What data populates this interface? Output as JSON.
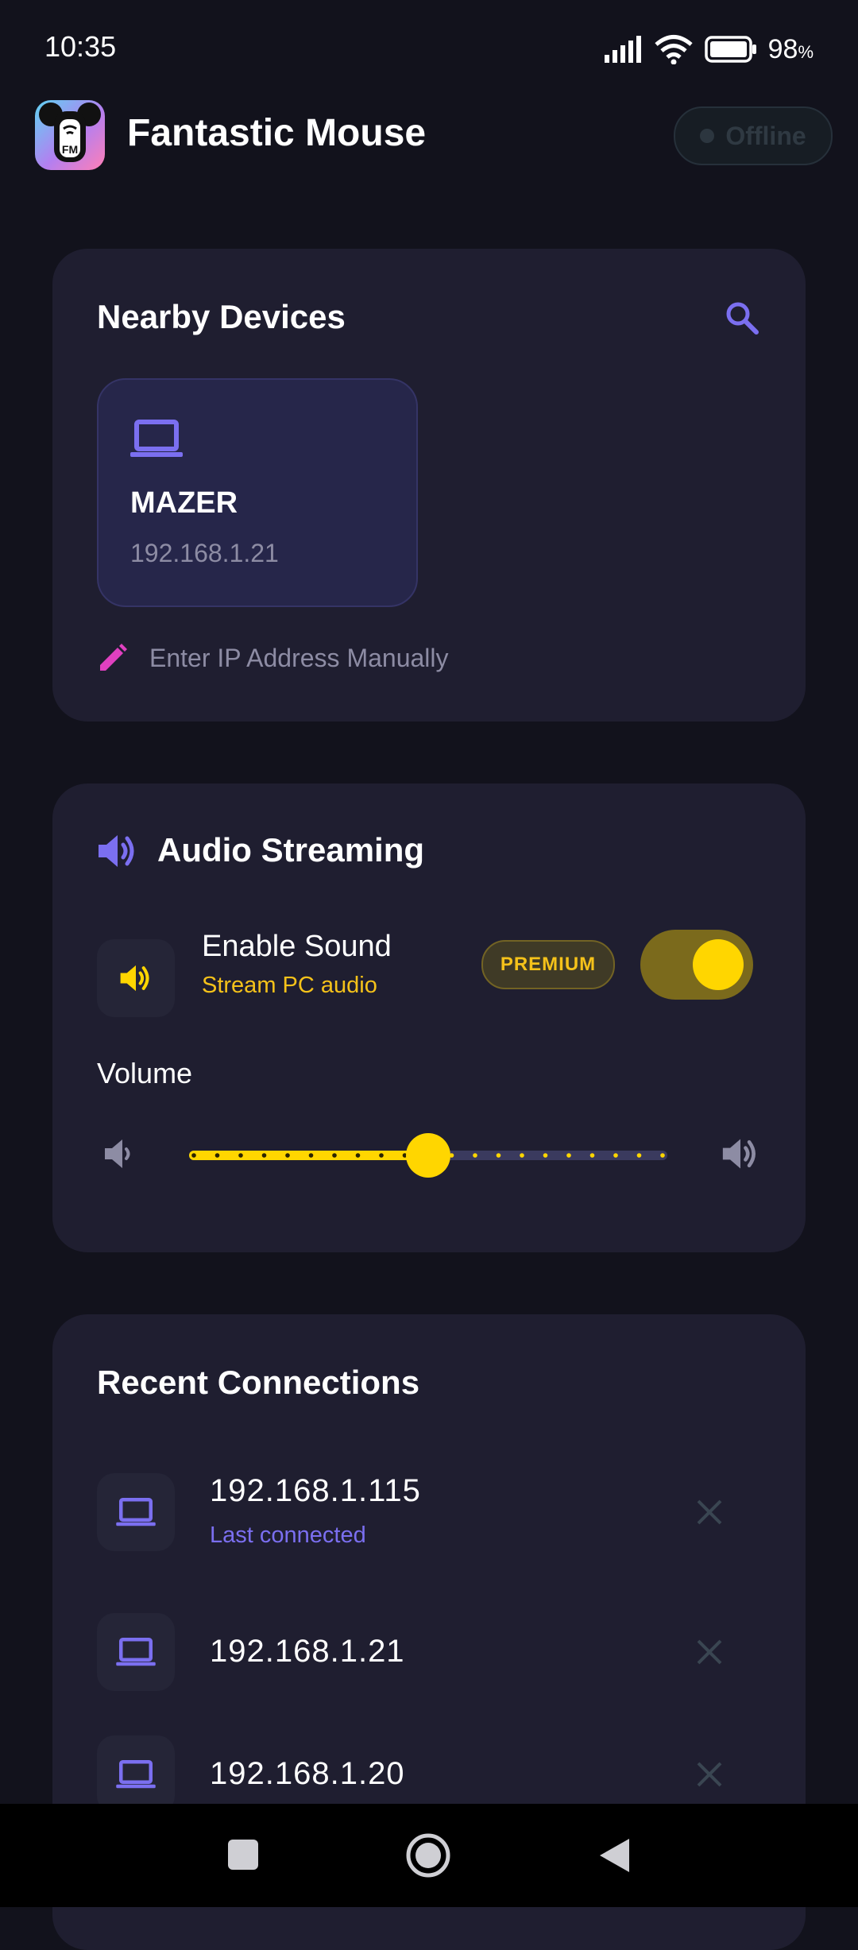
{
  "status_bar": {
    "time": "10:35",
    "battery": "98",
    "battery_unit": "%"
  },
  "header": {
    "title": "Fantastic Mouse",
    "logo_text": "FM",
    "status": "Offline"
  },
  "nearby": {
    "title": "Nearby Devices",
    "device": {
      "name": "MAZER",
      "ip": "192.168.1.21"
    },
    "manual_label": "Enter IP Address Manually"
  },
  "audio": {
    "title": "Audio Streaming",
    "enable_label": "Enable Sound",
    "enable_sub": "Stream PC audio",
    "premium": "PREMIUM",
    "enabled": true,
    "volume_label": "Volume",
    "volume_fraction": 0.5,
    "volume_steps": 20
  },
  "recent": {
    "title": "Recent Connections",
    "items": [
      {
        "ip": "192.168.1.115",
        "sub": "Last connected"
      },
      {
        "ip": "192.168.1.21"
      },
      {
        "ip": "192.168.1.20"
      }
    ]
  },
  "colors": {
    "accent_purple": "#7b6ff0",
    "accent_yellow": "#ffd600",
    "accent_pink": "#e040c0",
    "card_bg": "#1f1e30",
    "page_bg": "#12121c"
  },
  "icons": {
    "search": "search-icon",
    "laptop": "laptop-icon",
    "edit": "pencil-icon",
    "speaker": "speaker-icon",
    "close": "close-icon"
  }
}
